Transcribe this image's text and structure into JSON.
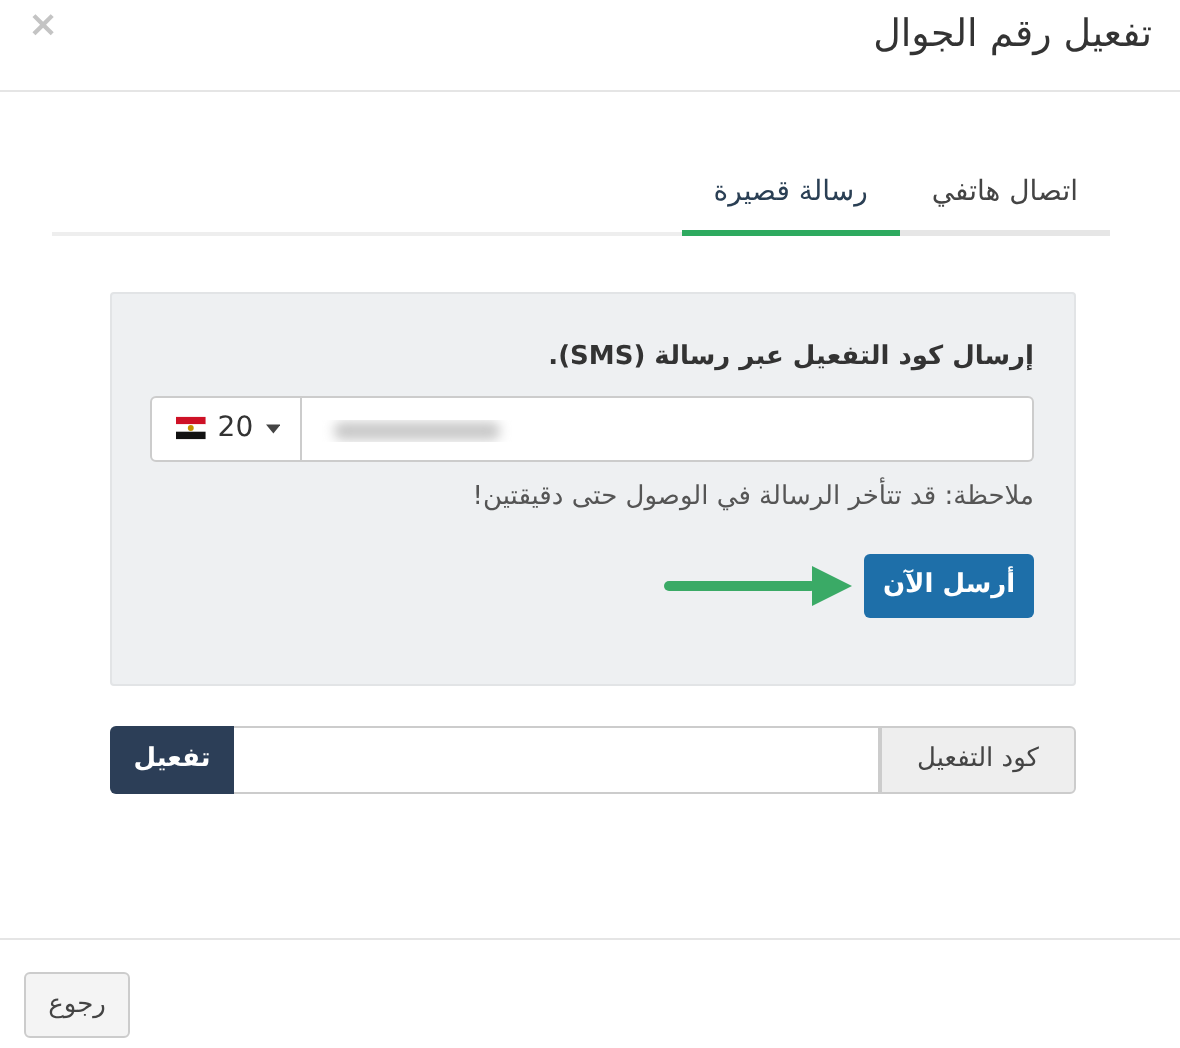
{
  "dialog": {
    "title": "تفعيل رقم الجوال",
    "close": "×"
  },
  "tabs": [
    {
      "label": "اتصال هاتفي",
      "selected": false
    },
    {
      "label": "رسالة قصيرة",
      "selected": true
    }
  ],
  "sms_panel": {
    "heading": "إرسال كود التفعيل عبر رسالة (SMS).",
    "country_code": "20",
    "note": "ملاحظة: قد تتأخر الرسالة في الوصول حتى دقيقتين!",
    "send_button": "أرسل الآن"
  },
  "activation": {
    "addon": "كود التفعيل",
    "button": "تفعيل"
  },
  "footer": {
    "back_button": "رجوع"
  }
}
